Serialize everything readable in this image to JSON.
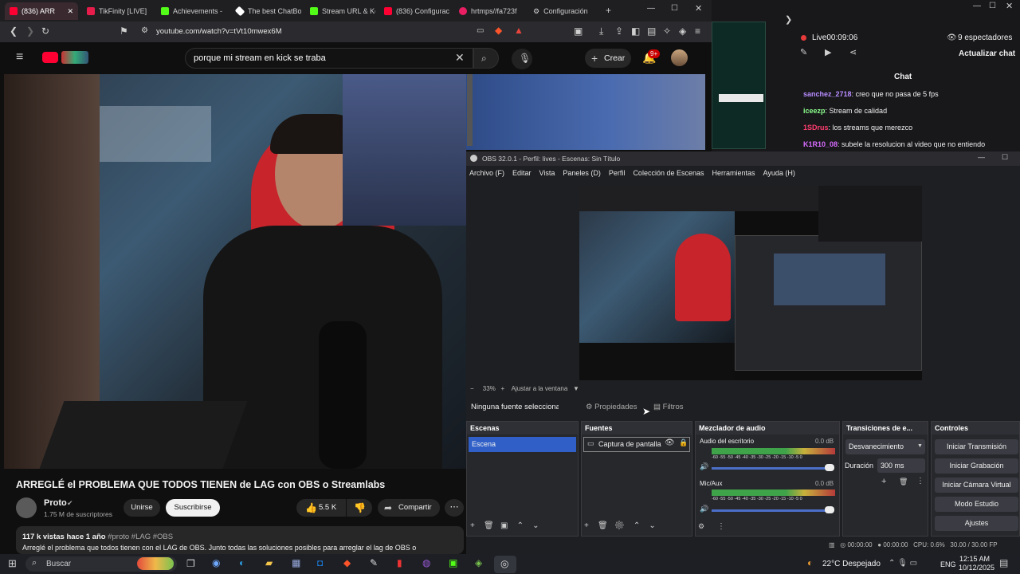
{
  "browser": {
    "tabs": [
      {
        "label": "(836) ARR",
        "color": "#ff0033"
      },
      {
        "label": "TikFinity [LIVE]",
        "color": "#e61d4a"
      },
      {
        "label": "Achievements -",
        "color": "#53fc18"
      },
      {
        "label": "The best ChatBo",
        "color": "#ffffff"
      },
      {
        "label": "Stream URL & Ke",
        "color": "#53fc18"
      },
      {
        "label": "(836) Configurac",
        "color": "#ff0033"
      },
      {
        "label": "hrtmps//fa723f",
        "color": "#e91e63"
      },
      {
        "label": "Configuración",
        "color": "#cfcfcf"
      }
    ],
    "url": "youtube.com/watch?v=tVt10mwex6M"
  },
  "youtube": {
    "search_value": "porque mi stream en kick se traba",
    "create_label": "Crear",
    "notif_badge": "9+",
    "video_title": "ARREGLÉ el PROBLEMA QUE TODOS TIENEN de LAG con OBS o Streamlabs",
    "channel": "Proto",
    "subscribers": "1.75 M de suscriptores",
    "join": "Unirse",
    "subscribe": "Suscribirse",
    "likes": "5.5 K",
    "share": "Compartir",
    "views": "117 k vistas",
    "age": "hace 1 año",
    "tags": "#proto #LAG #OBS",
    "desc": "Arreglé el problema que todos tienen con el LAG de OBS. Junto todas las soluciones posibles para arreglar el lag de OBS o"
  },
  "chat": {
    "live": "Live",
    "time": "00:09:06",
    "viewers": "9 espectadores",
    "update": "Actualizar chat",
    "title": "Chat",
    "messages": [
      {
        "user": "sanchez_2718",
        "text": "creo que no pasa de 5 fps",
        "color": "#b98cff"
      },
      {
        "user": "iceezp",
        "text": "Stream de calidad",
        "color": "#8cff8c"
      },
      {
        "user": "1SDrus",
        "text": "los streams que merezco",
        "color": "#ff3d6e"
      },
      {
        "user": "K1R10_08",
        "text": "subele la resolucion al video que no entiendo",
        "color": "#d96cff"
      }
    ]
  },
  "obs": {
    "title": "OBS 32.0.1 - Perfil: lives - Escenas: Sin Título",
    "menu": [
      "Archivo (F)",
      "Editar",
      "Vista",
      "Paneles (D)",
      "Perfil",
      "Colección de Escenas",
      "Herramientas",
      "Ayuda (H)"
    ],
    "zoom": "33%",
    "fit": "Ajustar a la ventana",
    "no_source": "Ninguna fuente seleccionac",
    "properties": "Propiedades",
    "filters": "Filtros",
    "scenes_title": "Escenas",
    "scene_item": "Escena",
    "sources_title": "Fuentes",
    "source_item": "Captura de pantalla",
    "mixer_title": "Mezclador de audio",
    "desktop_audio": "Audio del escritorio",
    "desktop_db": "0.0 dB",
    "mic": "Mic/Aux",
    "mic_db": "0.0 dB",
    "meter_ticks": "-60 -55 -50 -45 -40 -35 -30 -25 -20 -15 -10 -5 0",
    "transitions_title": "Transiciones de e...",
    "transition": "Desvanecimiento",
    "duration_label": "Duración",
    "duration": "300 ms",
    "controls_title": "Controles",
    "controls": [
      "Iniciar Transmisión",
      "Iniciar Grabación",
      "Iniciar Cámara Virtual",
      "Modo Estudio",
      "Ajustes"
    ],
    "status_time1": "00:00:00",
    "status_time2": "00:00:00",
    "cpu": "CPU: 0.6%",
    "fps": "30.00 / 30.00 FP"
  },
  "taskbar": {
    "search": "Buscar",
    "weather": "22°C  Despejado",
    "lang": "ENG",
    "time": "12:15 AM",
    "date": "10/12/2025"
  }
}
